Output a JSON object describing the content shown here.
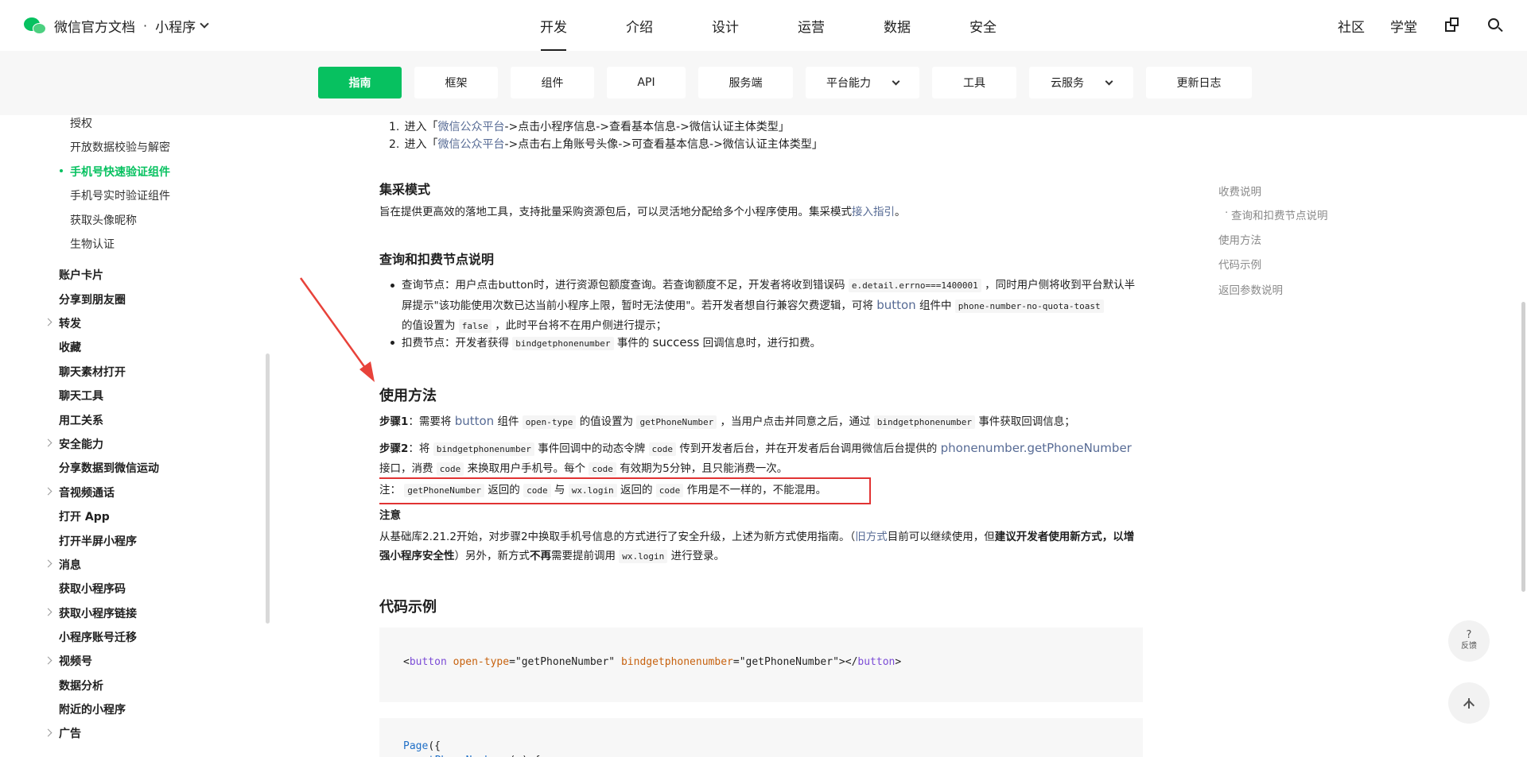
{
  "header": {
    "brand": "微信官方文档",
    "separator": "·",
    "product": "小程序",
    "nav": [
      "开发",
      "介绍",
      "设计",
      "运营",
      "数据",
      "安全"
    ],
    "right_links": [
      "社区",
      "学堂"
    ]
  },
  "subnav": [
    "指南",
    "框架",
    "组件",
    "API",
    "服务端",
    "平台能力",
    "工具",
    "云服务",
    "更新日志"
  ],
  "sidebar": {
    "sub_items": [
      "授权",
      "开放数据校验与解密",
      "手机号快速验证组件",
      "手机号实时验证组件",
      "获取头像昵称",
      "生物认证"
    ],
    "top_items": [
      "账户卡片",
      "分享到朋友圈",
      "转发",
      "收藏",
      "聊天素材打开",
      "聊天工具",
      "用工关系",
      "安全能力",
      "分享数据到微信运动",
      "音视频通话",
      "打开 App",
      "打开半屏小程序",
      "消息",
      "获取小程序码",
      "获取小程序链接",
      "小程序账号迁移",
      "视频号",
      "数据分析",
      "附近的小程序",
      "广告"
    ]
  },
  "content": {
    "ol": [
      {
        "num": "1.",
        "pre": "进入「",
        "link": "微信公众平台",
        "post": "->点击小程序信息->查看基本信息->微信认证主体类型」"
      },
      {
        "num": "2.",
        "pre": "进入「",
        "link": "微信公众平台",
        "post": "->点击右上角账号头像->可查看基本信息->微信认证主体类型」"
      }
    ],
    "jicai_title": "集采模式",
    "jicai_text": "旨在提供更高效的落地工具，支持批量采购资源包后，可以灵活地分配给多个小程序使用。集采模式",
    "jicai_link": "接入指引",
    "jicai_end": "。",
    "query_title": "查询和扣费节点说明",
    "query_item1_a": "查询节点：用户点击button时，进行资源包额度查询。若查询额度不足，开发者将收到错误码",
    "query_item1_code1": "e.detail.errno===1400001",
    "query_item1_b": "，同时用户侧将收到平台默认半屏提示\"该功能使用次数已达当前小程序上限，暂时无法使用\"。若开发者想自行兼容欠费逻辑，可将",
    "query_item1_link": "button",
    "query_item1_c": "组件中",
    "query_item1_code2": "phone-number-no-quota-toast",
    "query_item1_d": "的值设置为",
    "query_item1_code3": "false",
    "query_item1_e": "，此时平台将不在用户侧进行提示；",
    "query_item2_a": "扣费节点：开发者获得",
    "query_item2_code": "bindgetphonenumber",
    "query_item2_b": "事件的",
    "query_item2_success": "success",
    "query_item2_c": "回调信息时，进行扣费。",
    "usage_title": "使用方法",
    "step1_label": "步骤1",
    "step1_a": "：需要将",
    "step1_link": "button",
    "step1_b": "组件",
    "step1_code1": "open-type",
    "step1_c": "的值设置为",
    "step1_code2": "getPhoneNumber",
    "step1_d": "，当用户点击并同意之后，通过",
    "step1_code3": "bindgetphonenumber",
    "step1_e": "事件获取回调信息；",
    "step2_label": "步骤2",
    "step2_a": "：将",
    "step2_code1": "bindgetphonenumber",
    "step2_b": "事件回调中的动态令牌",
    "step2_code2": "code",
    "step2_c": "传到开发者后台，并在开发者后台调用微信后台提供的",
    "step2_link": "phonenumber.getPhoneNumber",
    "step2_d": "接口，消费",
    "step2_code3": "code",
    "step2_e": "来换取用户手机号。每个",
    "step2_code4": "code",
    "step2_f": "有效期为5分钟，且只能消费一次。",
    "note_a": "注：",
    "note_code1": "getPhoneNumber",
    "note_b": "返回的",
    "note_code2": "code",
    "note_c": "与",
    "note_code3": "wx.login",
    "note_d": "返回的",
    "note_code4": "code",
    "note_e": "作用是不一样的，不能混用。",
    "attention_title": "注意",
    "attention_a": "从基础库2.21.2开始，对步骤2中换取手机号信息的方式进行了安全升级，上述为新方式使用指南。（",
    "attention_link": "旧方式",
    "attention_b": "目前可以继续使用，但",
    "attention_bold1": "建议开发者使用新方式，以增强小程序安全性",
    "attention_c": "）另外，新方式",
    "attention_bold2": "不再",
    "attention_d": "需要提前调用",
    "attention_code": "wx.login",
    "attention_e": "进行登录。",
    "code_title": "代码示例",
    "code1": {
      "open_lt": "<",
      "tag": "button",
      "attr1": "open-type",
      "eq1": "=",
      "val1": "\"getPhoneNumber\"",
      "attr2": "bindgetphonenumber",
      "eq2": "=",
      "val2": "\"getPhoneNumber\"",
      "close_gt": "></",
      "tag2": "button",
      "end_gt": ">"
    },
    "code2_line1_fn": "Page",
    "code2_line1_rest": "({",
    "code2_line2_fn": "getPhoneNumber",
    "code2_line2_rest": " (",
    "code2_line2_param": "e",
    "code2_line2_end": ") {"
  },
  "toc": [
    "收费说明",
    "查询和扣费节点说明",
    "使用方法",
    "代码示例",
    "返回参数说明"
  ],
  "float": {
    "feedback_q": "?",
    "feedback_label": "反馈"
  },
  "colors": {
    "accent": "#07c160",
    "link": "#576b95",
    "highlight_box": "#e13333",
    "arrow": "#e8423a"
  }
}
